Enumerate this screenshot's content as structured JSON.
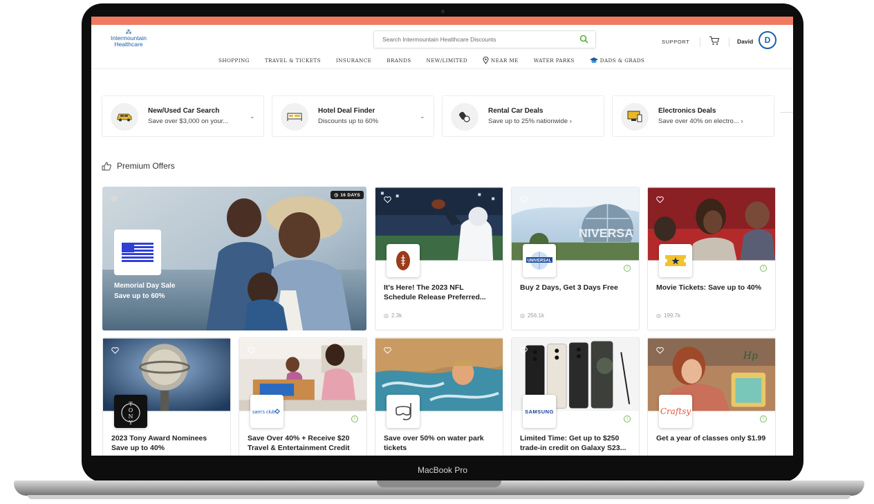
{
  "device": {
    "label": "MacBook Pro"
  },
  "header": {
    "logo_line1": "Intermountain",
    "logo_line2": "Healthcare",
    "search_placeholder": "Search Intermountain Healthcare Discounts",
    "support_label": "SUPPORT",
    "user_name": "David",
    "avatar_initial": "D"
  },
  "nav": {
    "items": [
      "SHOPPING",
      "TRAVEL & TICKETS",
      "INSURANCE",
      "BRANDS",
      "NEW/LIMITED",
      "NEAR ME",
      "WATER PARKS",
      "DADS & GRADS"
    ]
  },
  "quick_links": [
    {
      "title": "New/Used Car Search",
      "subtitle": "Save over $3,000 on your...",
      "icon": "car-icon",
      "chevron": "chevron-down-icon"
    },
    {
      "title": "Hotel Deal Finder",
      "subtitle": "Discounts up to 60%",
      "icon": "bed-icon",
      "chevron": "chevron-down-icon"
    },
    {
      "title": "Rental Car Deals",
      "subtitle": "Save up to 25% nationwide",
      "icon": "car-key-icon",
      "chevron": "chevron-right-icon"
    },
    {
      "title": "Electronics Deals",
      "subtitle": "Save over 40% on electro...",
      "icon": "monitor-icon",
      "chevron": "chevron-right-icon"
    }
  ],
  "section": {
    "title": "Premium Offers"
  },
  "featured": {
    "badge": "16 DAYS",
    "title": "Memorial Day Sale",
    "subtitle": "Save up to 60%"
  },
  "offers": [
    {
      "title": "It's Here! The 2023 NFL Schedule Release Preferred...",
      "views": "2.3k",
      "brand": "football"
    },
    {
      "title": "Buy 2 Days, Get 3 Days Free",
      "views": "256.1k",
      "brand": "UNIVERSAL"
    },
    {
      "title": "Movie Tickets: Save up to 40%",
      "views": "199.7k",
      "brand": "ticket"
    },
    {
      "title": "2023 Tony Award Nominees Save up to 40%",
      "brand": "TONY"
    },
    {
      "title": "Save Over 40% + Receive $20 Travel & Entertainment Credit",
      "brand": "sam's club"
    },
    {
      "title": "Save over 50% on water park tickets",
      "brand": "snorkel"
    },
    {
      "title": "Limited Time: Get up to $250 trade-in credit on Galaxy S23...",
      "brand": "SAMSUNG"
    },
    {
      "title": "Get a year of classes only $1.99",
      "brand": "Craftsy"
    }
  ],
  "colors": {
    "accent_bar": "#ef7a61",
    "brand_blue": "#1b5ea6",
    "info_green": "#7bb95a"
  }
}
